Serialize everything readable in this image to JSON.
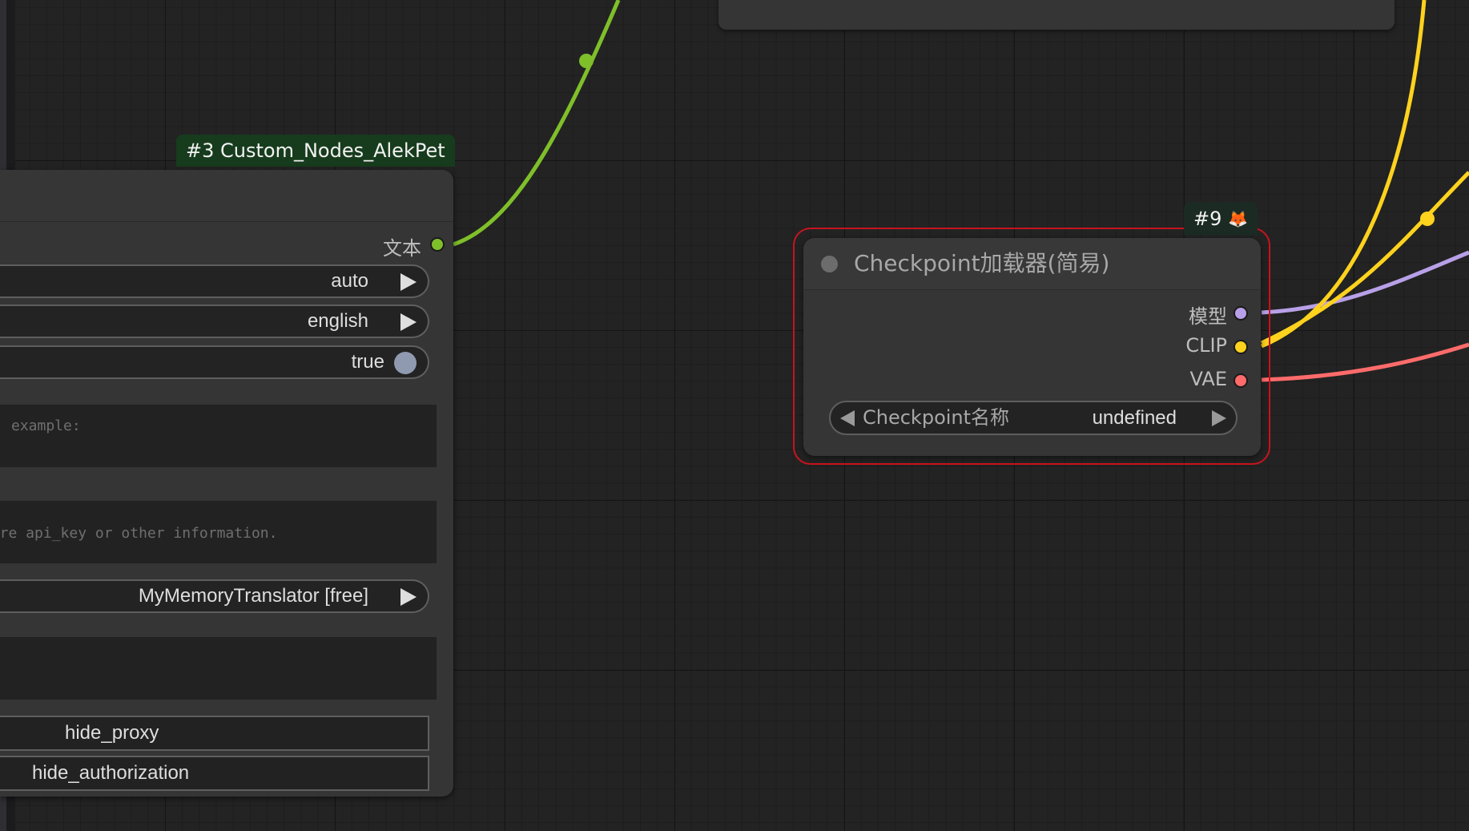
{
  "canvas": {
    "wire_colors": {
      "string": "#7fbf2a",
      "model": "#b8a0e8",
      "clip": "#ffd21e",
      "vae": "#ff6b6b"
    }
  },
  "translate_node": {
    "badge": "#3 Custom_Nodes_AlekPet",
    "output_label": "文本",
    "output_color": "#7fbf2a",
    "from_language": "auto",
    "to_language": "english",
    "toggle_value": "true",
    "text_placeholder": "example:",
    "auth_placeholder": "uire api_key or other information.",
    "translator": "MyMemoryTranslator [free]",
    "hide_proxy_label": "hide_proxy",
    "hide_authorization_label": "hide_authorization"
  },
  "checkpoint_node": {
    "badge": "#9",
    "badge_icon": "fox-icon",
    "title": "Checkpoint加载器(简易)",
    "outputs": [
      {
        "label": "模型",
        "color": "#b8a0e8"
      },
      {
        "label": "CLIP",
        "color": "#ffd21e"
      },
      {
        "label": "VAE",
        "color": "#ff6b6b"
      }
    ],
    "combo_label": "Checkpoint名称",
    "combo_value": "undefined",
    "selected_outline_color": "#c8141e"
  }
}
